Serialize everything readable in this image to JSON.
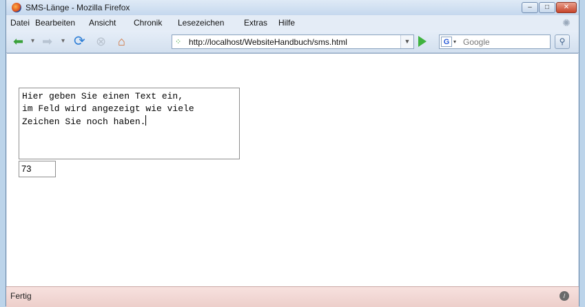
{
  "window": {
    "title": "SMS-Länge - Mozilla Firefox"
  },
  "menu": {
    "items": [
      "Datei",
      "Bearbeiten",
      "Ansicht",
      "Chronik",
      "Lesezeichen",
      "Extras",
      "Hilfe"
    ]
  },
  "toolbar": {
    "url": "http://localhost/WebsiteHandbuch/sms.html",
    "search_placeholder": "Google"
  },
  "page": {
    "textarea_text": "Hier geben Sie einen Text ein,\nim Feld wird angezeigt wie viele\nZeichen Sie noch haben.",
    "counter_value": "73"
  },
  "status": {
    "text": "Fertig"
  }
}
